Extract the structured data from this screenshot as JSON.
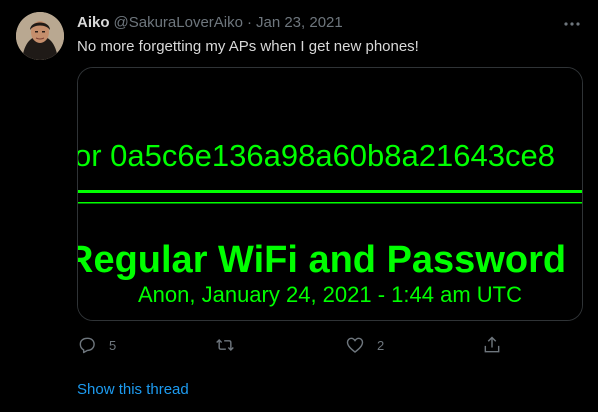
{
  "tweet": {
    "author_name": "Aiko",
    "author_handle": "@SakuraLoverAiko",
    "separator": "·",
    "date": "Jan 23, 2021",
    "text": "No more forgetting my APs when I get new phones!",
    "media": {
      "line1": "or 0a5c6e136a98a60b8a21643ce8",
      "line2": "Regular WiFi and Password",
      "line3": "Anon, January 24, 2021 - 1:44 am UTC",
      "text_color": "#00ff00"
    },
    "actions": {
      "reply_count": "5",
      "retweet_count": "",
      "like_count": "2"
    },
    "show_thread": "Show this thread"
  },
  "colors": {
    "background": "#000000",
    "primary_text": "#d9d9d9",
    "secondary_text": "#6e767d",
    "link": "#1d9bf0",
    "border": "#2f3336"
  },
  "icons": {
    "more": "more-dots-icon",
    "reply": "reply-bubble-icon",
    "retweet": "retweet-arrows-icon",
    "like": "heart-icon",
    "share": "share-upload-icon"
  }
}
